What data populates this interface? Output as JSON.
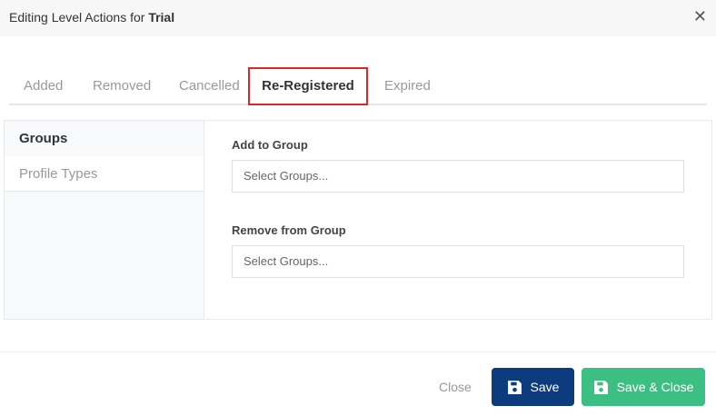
{
  "header": {
    "title_prefix": "Editing Level Actions for ",
    "title_name": "Trial"
  },
  "tabs": [
    {
      "label": "Added"
    },
    {
      "label": "Removed"
    },
    {
      "label": "Cancelled"
    },
    {
      "label": "Re-Registered",
      "active": true
    },
    {
      "label": "Expired"
    }
  ],
  "sidebar": {
    "items": [
      {
        "label": "Groups",
        "active": true
      },
      {
        "label": "Profile Types"
      }
    ]
  },
  "form": {
    "add_label": "Add to Group",
    "add_placeholder": "Select Groups...",
    "remove_label": "Remove from Group",
    "remove_placeholder": "Select Groups..."
  },
  "footer": {
    "close_label": "Close",
    "save_label": "Save",
    "save_close_label": "Save & Close"
  },
  "colors": {
    "save": "#0d3c7e",
    "save_close": "#3cbf82",
    "highlight": "#e3242b"
  }
}
